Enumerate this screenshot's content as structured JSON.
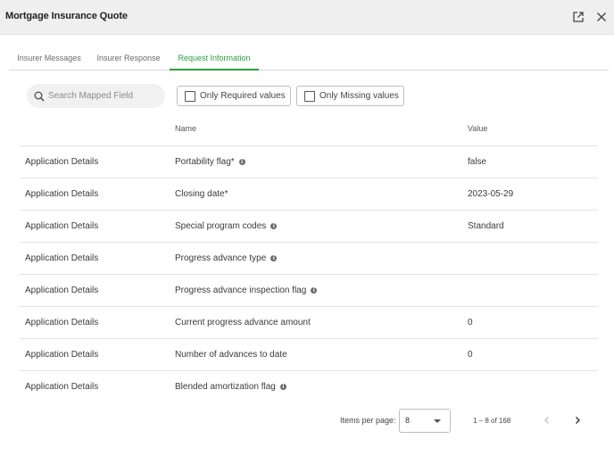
{
  "window": {
    "title": "Mortgage Insurance Quote",
    "popout_icon": "open-in-new-icon",
    "close_icon": "close-icon"
  },
  "tabs": [
    {
      "label": "Insurer Messages",
      "active": false
    },
    {
      "label": "Insurer Response",
      "active": false
    },
    {
      "label": "Request Information",
      "active": true
    }
  ],
  "toolbar": {
    "search_placeholder": "Search Mapped Field",
    "search_icon": "search-icon",
    "filter_required_label": "Only Required values",
    "filter_missing_label": "Only Missing values"
  },
  "table": {
    "columns": {
      "section": "",
      "name": "Name",
      "value": "Value"
    },
    "rows": [
      {
        "section": "Application Details",
        "name": "Portability flag*",
        "info": true,
        "value": "false"
      },
      {
        "section": "Application Details",
        "name": "Closing date*",
        "info": false,
        "value": "2023-05-29"
      },
      {
        "section": "Application Details",
        "name": "Special program codes",
        "info": true,
        "value": "Standard"
      },
      {
        "section": "Application Details",
        "name": "Progress advance type",
        "info": true,
        "value": ""
      },
      {
        "section": "Application Details",
        "name": "Progress advance inspection flag",
        "info": true,
        "value": ""
      },
      {
        "section": "Application Details",
        "name": "Current progress advance amount",
        "info": false,
        "value": "0"
      },
      {
        "section": "Application Details",
        "name": "Number of advances to date",
        "info": false,
        "value": "0"
      },
      {
        "section": "Application Details",
        "name": "Blended amortization flag",
        "info": true,
        "value": ""
      }
    ]
  },
  "paginator": {
    "items_per_page_label": "Items per page:",
    "items_per_page_value": "8",
    "range_label": "1 – 8 of 168",
    "prev_icon": "chevron-left-icon",
    "next_icon": "chevron-right-icon"
  },
  "colors": {
    "accent": "#2e9e3e",
    "titlebar_bg": "#efefef",
    "info_icon": "#6a6a6a"
  }
}
